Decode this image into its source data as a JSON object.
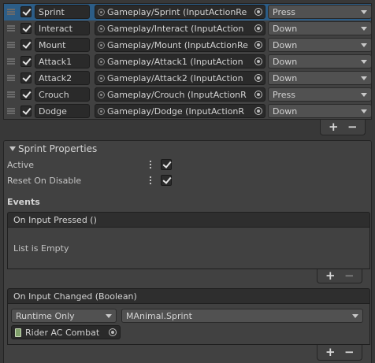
{
  "actions": [
    {
      "name": "Sprint",
      "action": "Gameplay/Sprint (InputActionRe",
      "mode": "Press",
      "selected": true
    },
    {
      "name": "Interact",
      "action": "Gameplay/Interact (InputAction",
      "mode": "Down",
      "selected": false
    },
    {
      "name": "Mount",
      "action": "Gameplay/Mount (InputActionRe",
      "mode": "Down",
      "selected": false
    },
    {
      "name": "Attack1",
      "action": "Gameplay/Attack1 (InputAction",
      "mode": "Down",
      "selected": false
    },
    {
      "name": "Attack2",
      "action": "Gameplay/Attack2 (InputAction",
      "mode": "Down",
      "selected": false
    },
    {
      "name": "Crouch",
      "action": "Gameplay/Crouch (InputActionR",
      "mode": "Press",
      "selected": false
    },
    {
      "name": "Dodge",
      "action": "Gameplay/Dodge (InputActionR",
      "mode": "Down",
      "selected": false
    }
  ],
  "list_controls": {
    "add": "+",
    "remove": "−"
  },
  "properties": {
    "title": "Sprint Properties",
    "active_label": "Active",
    "active_checked": true,
    "reset_label": "Reset On Disable",
    "reset_checked": true,
    "events_label": "Events"
  },
  "event_pressed": {
    "title": "On Input Pressed ()",
    "empty_text": "List is Empty",
    "add": "+",
    "remove": "−"
  },
  "event_changed": {
    "title": "On Input Changed (Boolean)",
    "runtime_option": "Runtime Only",
    "function": "MAnimal.Sprint",
    "target": "Rider AC Combat",
    "add": "+",
    "remove": "−"
  },
  "colors": {
    "selection": "#2c5d87",
    "panel": "#383838"
  }
}
